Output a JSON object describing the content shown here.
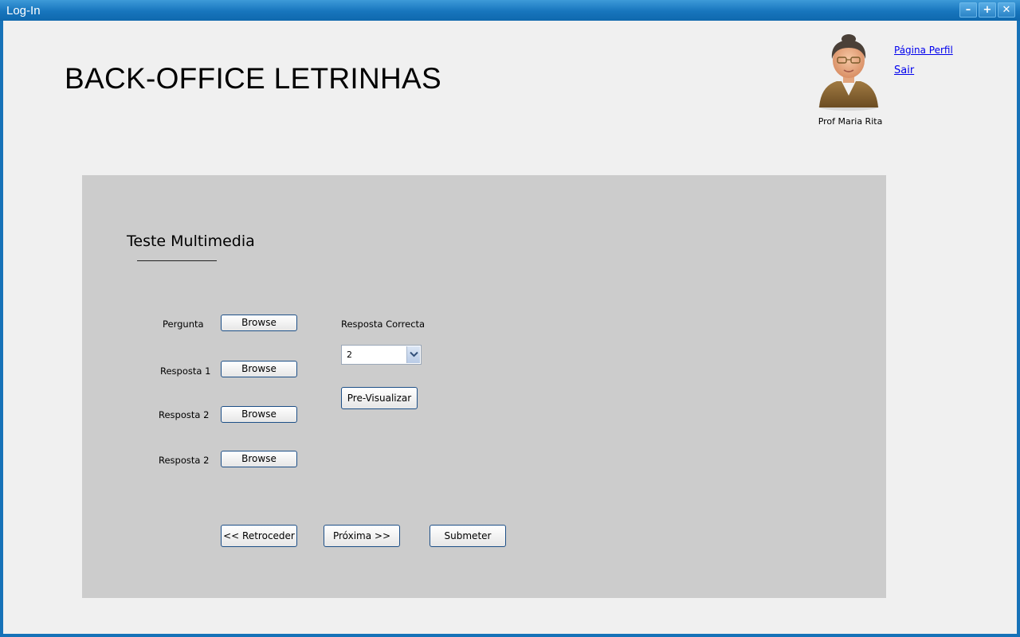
{
  "window": {
    "title": "Log-In",
    "controls": {
      "minimize": "–",
      "maximize": "+",
      "close": "✕"
    }
  },
  "header": {
    "app_title": "BACK-OFFICE LETRINHAS",
    "user_name": "Prof Maria Rita",
    "profile_link": "Página Perfil",
    "exit_link": "Sair",
    "avatar_icon": "teacher-avatar-icon"
  },
  "panel": {
    "title": "Teste Multimedia",
    "rows": [
      {
        "label": "Pergunta",
        "button": "Browse"
      },
      {
        "label": "Resposta 1",
        "button": "Browse"
      },
      {
        "label": "Resposta 2",
        "button": "Browse"
      },
      {
        "label": "Resposta 2",
        "button": "Browse"
      }
    ],
    "correct_answer": {
      "label": "Resposta Correcta",
      "selected": "2"
    },
    "preview_button": "Pre-Visualizar",
    "nav": {
      "back": "<<  Retroceder",
      "next": "Próxima  >>",
      "submit": "Submeter"
    }
  },
  "colors": {
    "titlebar": "#1775bd",
    "window_border": "#1672b8",
    "panel_bg": "#cccccc",
    "button_border": "#1d4f87",
    "link": "#0000ee"
  }
}
